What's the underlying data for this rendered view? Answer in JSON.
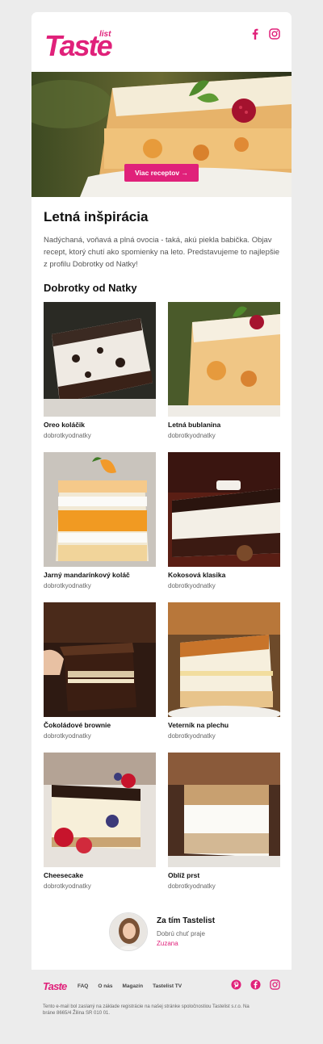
{
  "brand": {
    "logo_text": "Taste",
    "logo_sub": "list",
    "accent": "#e0217a"
  },
  "header": {
    "social": [
      {
        "name": "facebook-icon"
      },
      {
        "name": "instagram-icon"
      }
    ]
  },
  "hero": {
    "button_label": "Viac receptov →"
  },
  "intro": {
    "title": "Letná inšpirácia",
    "text": "Nadýchaná, voňavá a plná ovocia - taká, akú piekla babička. Objav recept, ktorý chutí ako spomienky na leto. Predstavujeme to najlepšie z profilu Dobrotky od Natky!"
  },
  "section": {
    "title": "Dobrotky od Natky"
  },
  "recipes": [
    {
      "name": "Oreo koláčik",
      "author": "dobrotkyodnatky"
    },
    {
      "name": "Letná bublanina",
      "author": "dobrotkyodnatky"
    },
    {
      "name": "Jarný mandarínkový koláč",
      "author": "dobrotkyodnatky"
    },
    {
      "name": "Kokosová klasika",
      "author": "dobrotkyodnatky"
    },
    {
      "name": "Čokoládové brownie",
      "author": "dobrotkyodnatky"
    },
    {
      "name": "Veterník na plechu",
      "author": "dobrotkyodnatky"
    },
    {
      "name": "Cheesecake",
      "author": "dobrotkyodnatky"
    },
    {
      "name": "Oblíž prst",
      "author": "dobrotkyodnatky"
    }
  ],
  "signature": {
    "title": "Za tím Tastelist",
    "subtitle": "Dobrú chuť praje",
    "name": "Zuzana"
  },
  "footer": {
    "links": [
      "FAQ",
      "O nás",
      "Magazín",
      "Tastelist TV"
    ],
    "note": "Tento e-mail bol zaslaný na základe registrácie na našej stránke spoločnostiou Tastelist s.r.o. Na bráne 8665/4 Žilina SR 010 01."
  }
}
